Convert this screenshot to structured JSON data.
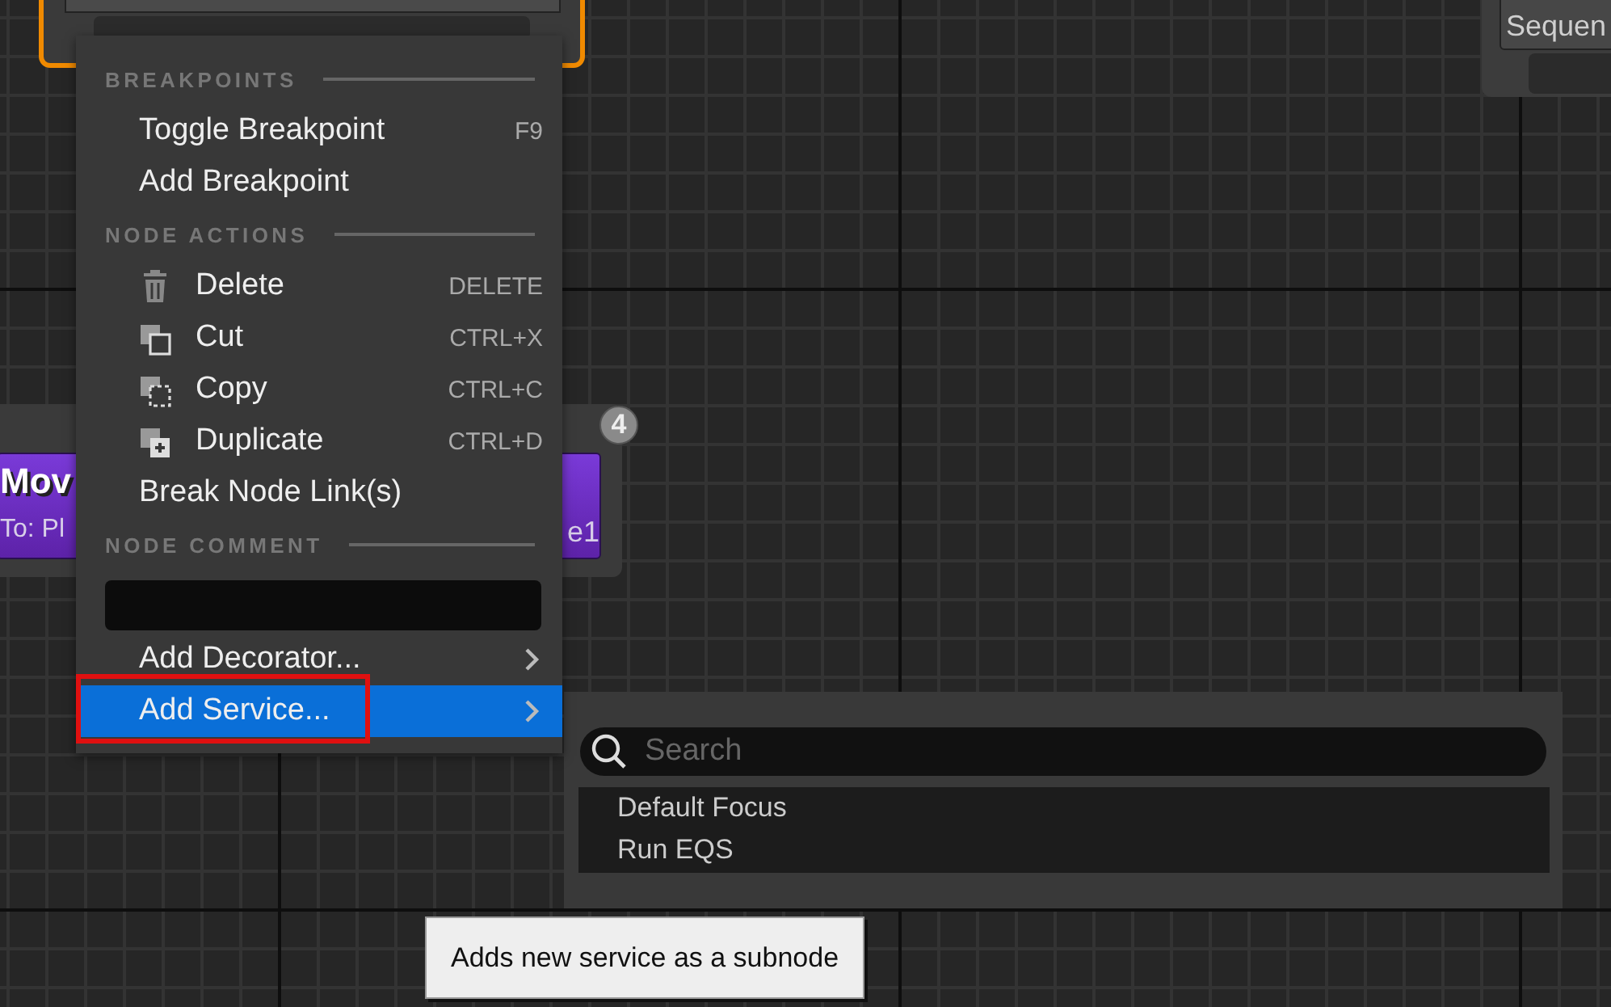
{
  "canvas": {
    "nodes": [
      {
        "kind": "selected",
        "selected": true
      },
      {
        "kind": "sequence",
        "selected": false,
        "title": "Sequen"
      },
      {
        "kind": "task",
        "selected": false,
        "title": "Mov",
        "subtitle": "To: Pl",
        "tail": "e1",
        "badge": "4"
      }
    ]
  },
  "context_menu": {
    "sections": [
      {
        "header": "BREAKPOINTS",
        "items": [
          {
            "kind": "plain",
            "label": "Toggle Breakpoint",
            "shortcut": "F9",
            "selected": false,
            "annotated": false
          },
          {
            "kind": "plain",
            "label": "Add Breakpoint",
            "selected": false,
            "annotated": false
          }
        ]
      },
      {
        "header": "NODE ACTIONS",
        "items": [
          {
            "kind": "delete",
            "label": "Delete",
            "shortcut": "DELETE",
            "selected": false,
            "annotated": false
          },
          {
            "kind": "cut",
            "label": "Cut",
            "shortcut": "CTRL+X",
            "selected": false,
            "annotated": false
          },
          {
            "kind": "copy",
            "label": "Copy",
            "shortcut": "CTRL+C",
            "selected": false,
            "annotated": false
          },
          {
            "kind": "duplicate",
            "label": "Duplicate",
            "shortcut": "CTRL+D",
            "selected": false,
            "annotated": false
          },
          {
            "kind": "plain",
            "label": "Break Node Link(s)",
            "selected": false,
            "annotated": false
          }
        ]
      },
      {
        "header": "NODE COMMENT",
        "items": [
          {
            "kind": "field"
          },
          {
            "kind": "submenu",
            "label": "Add Decorator...",
            "selected": false,
            "annotated": false
          },
          {
            "kind": "submenu",
            "label": "Add Service...",
            "selected": true,
            "annotated": true
          }
        ]
      }
    ]
  },
  "submenu": {
    "search": {
      "placeholder": "Search"
    },
    "items": [
      {
        "label": "Default Focus"
      },
      {
        "label": "Run EQS"
      }
    ]
  },
  "tooltip": {
    "text": "Adds new service as a subnode"
  }
}
